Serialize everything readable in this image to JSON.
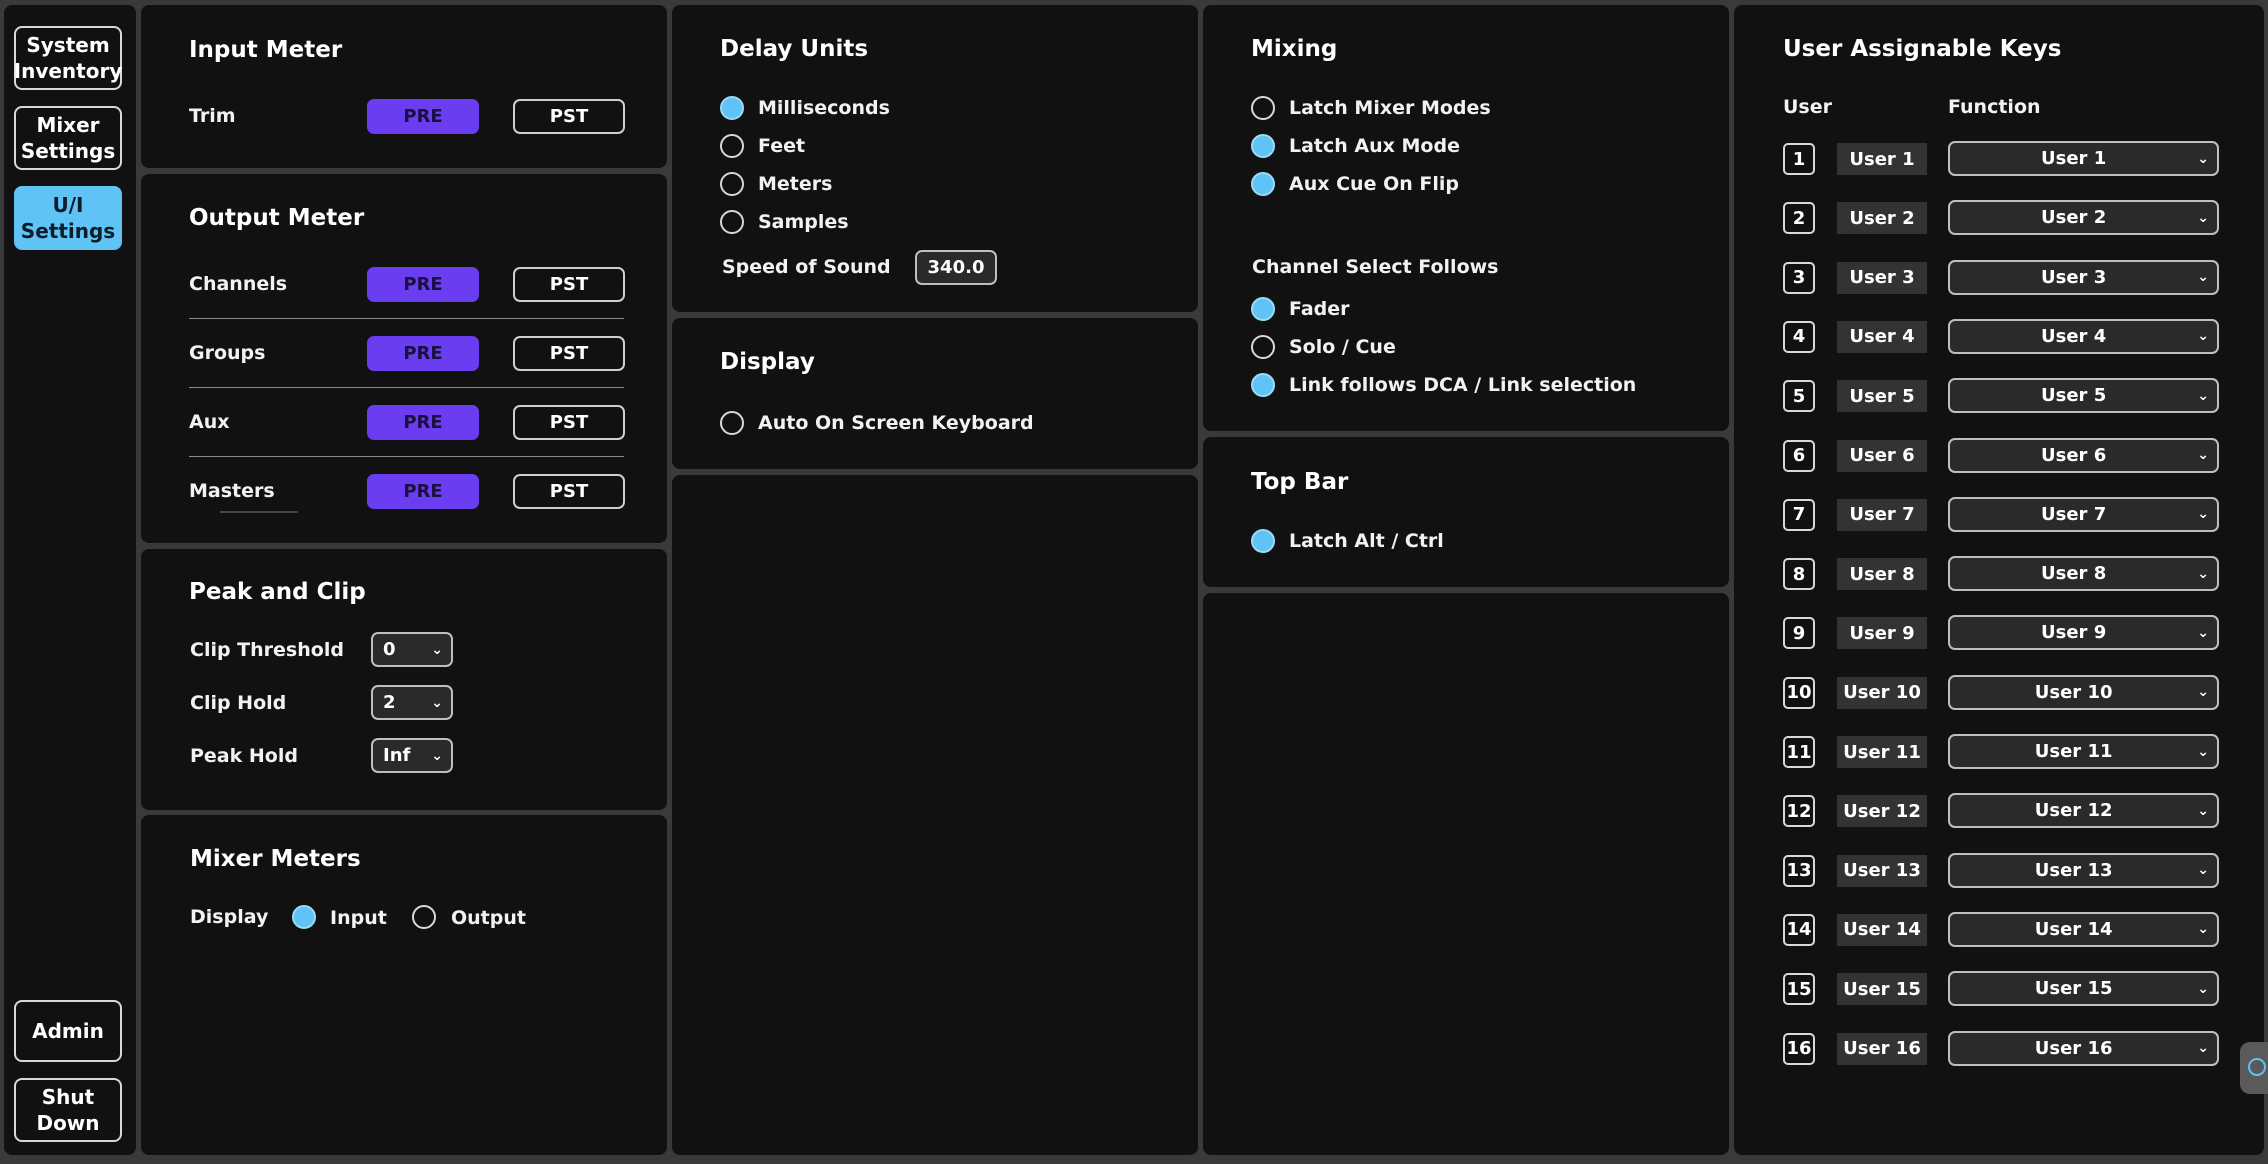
{
  "nav": {
    "system_inventory": "System Inventory",
    "mixer_settings": "Mixer Settings",
    "ui_settings": "U/I Settings",
    "admin": "Admin",
    "shut_down": "Shut Down"
  },
  "input_meter": {
    "title": "Input Meter",
    "rows": [
      {
        "label": "Trim",
        "selected": "PRE"
      }
    ]
  },
  "output_meter": {
    "title": "Output Meter",
    "rows": [
      {
        "label": "Channels",
        "selected": "PRE"
      },
      {
        "label": "Groups",
        "selected": "PRE"
      },
      {
        "label": "Aux",
        "selected": "PRE"
      },
      {
        "label": "Masters",
        "selected": "PRE"
      }
    ]
  },
  "toggle": {
    "pre": "PRE",
    "pst": "PST"
  },
  "peak_clip": {
    "title": "Peak and Clip",
    "clip_threshold": {
      "label": "Clip Threshold",
      "value": "0"
    },
    "clip_hold": {
      "label": "Clip Hold",
      "value": "2"
    },
    "peak_hold": {
      "label": "Peak Hold",
      "value": "Inf"
    }
  },
  "mixer_meters": {
    "title": "Mixer Meters",
    "display_label": "Display",
    "options": [
      {
        "label": "Input",
        "checked": true
      },
      {
        "label": "Output",
        "checked": false
      }
    ]
  },
  "delay_units": {
    "title": "Delay Units",
    "options": [
      {
        "label": "Milliseconds",
        "checked": true
      },
      {
        "label": "Feet",
        "checked": false
      },
      {
        "label": "Meters",
        "checked": false
      },
      {
        "label": "Samples",
        "checked": false
      }
    ],
    "speed_label": "Speed of Sound",
    "speed_value": "340.0"
  },
  "display": {
    "title": "Display",
    "options": [
      {
        "label": "Auto On Screen Keyboard",
        "checked": false
      }
    ]
  },
  "mixing": {
    "title": "Mixing",
    "options": [
      {
        "label": "Latch Mixer Modes",
        "checked": false
      },
      {
        "label": "Latch Aux Mode",
        "checked": true
      },
      {
        "label": "Aux Cue On Flip",
        "checked": true
      }
    ],
    "channel_select_title": "Channel Select Follows",
    "channel_select": [
      {
        "label": "Fader",
        "checked": true
      },
      {
        "label": "Solo / Cue",
        "checked": false
      },
      {
        "label": "Link follows DCA / Link selection",
        "checked": true
      }
    ]
  },
  "top_bar": {
    "title": "Top Bar",
    "options": [
      {
        "label": "Latch Alt / Ctrl",
        "checked": true
      }
    ]
  },
  "user_keys": {
    "title": "User Assignable Keys",
    "col_user": "User",
    "col_function": "Function",
    "keys": [
      {
        "num": "1",
        "user": "User 1",
        "function": "User 1"
      },
      {
        "num": "2",
        "user": "User 2",
        "function": "User 2"
      },
      {
        "num": "3",
        "user": "User 3",
        "function": "User 3"
      },
      {
        "num": "4",
        "user": "User 4",
        "function": "User 4"
      },
      {
        "num": "5",
        "user": "User 5",
        "function": "User 5"
      },
      {
        "num": "6",
        "user": "User 6",
        "function": "User 6"
      },
      {
        "num": "7",
        "user": "User 7",
        "function": "User 7"
      },
      {
        "num": "8",
        "user": "User 8",
        "function": "User 8"
      },
      {
        "num": "9",
        "user": "User 9",
        "function": "User 9"
      },
      {
        "num": "10",
        "user": "User 10",
        "function": "User 10"
      },
      {
        "num": "11",
        "user": "User 11",
        "function": "User 11"
      },
      {
        "num": "12",
        "user": "User 12",
        "function": "User 12"
      },
      {
        "num": "13",
        "user": "User 13",
        "function": "User 13"
      },
      {
        "num": "14",
        "user": "User 14",
        "function": "User 14"
      },
      {
        "num": "15",
        "user": "User 15",
        "function": "User 15"
      },
      {
        "num": "16",
        "user": "User 16",
        "function": "User 16"
      }
    ]
  },
  "colors": {
    "accent_blue": "#5fc3f5",
    "accent_purple": "#6a3df0",
    "panel": "#111111",
    "background": "#3a3a3a"
  },
  "icons": {
    "dropdown": "chevron-down-icon",
    "edge_tab": "keyboard-toggle-icon"
  }
}
